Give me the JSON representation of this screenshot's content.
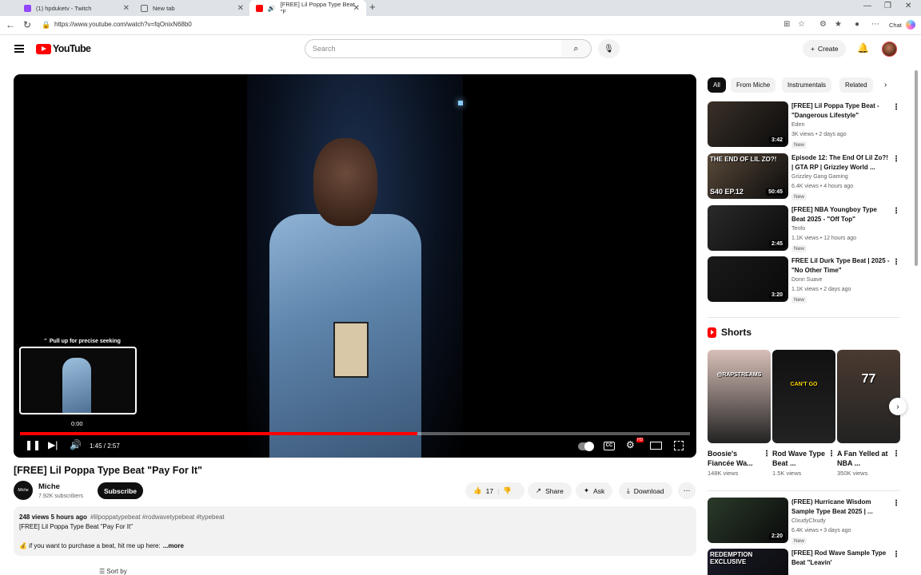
{
  "browser": {
    "tabs": [
      {
        "label": "(1) hpduketv - Twitch"
      },
      {
        "label": "New tab"
      },
      {
        "label": "[FREE] Lil Poppa Type Beat \"F"
      }
    ],
    "url": "https://www.youtube.com/watch?v=fqOnixN68b0",
    "chat_label": "Chat"
  },
  "header": {
    "logo": "YouTube",
    "search_placeholder": "Search",
    "create_label": "Create"
  },
  "player": {
    "seek_hint": "Pull up for precise seeking",
    "preview_time": "0:00",
    "time": "1:45 / 2:57",
    "progress_played_pct": 59.3,
    "progress_buffer_pct": 59.3,
    "cc_label": "CC",
    "settings_badge": "HD"
  },
  "video": {
    "title": "[FREE] Lil Poppa Type Beat \"Pay For It\"",
    "channel": "Miche",
    "channel_avatar_text": "Miche",
    "subscribers": "7.92K subscribers",
    "subscribe_label": "Subscribe",
    "likes": "17",
    "share_label": "Share",
    "ask_label": "Ask",
    "download_label": "Download"
  },
  "description": {
    "meta": "248 views  5 hours ago",
    "tags": "#lilpoppatypebeat #rodwavetypebeat #typebeat",
    "line1": "[FREE] Lil Poppa Type Beat \"Pay For It\"",
    "line2": "💰 if you want to purchase a beat, hit me up here:",
    "more": "...more"
  },
  "comments": {
    "sort_label": "Sort by"
  },
  "chips": [
    {
      "label": "All"
    },
    {
      "label": "From Miche"
    },
    {
      "label": "Instrumentals"
    },
    {
      "label": "Related"
    }
  ],
  "recommendations": [
    {
      "title": "[FREE] Lil Poppa Type Beat - \"Dangerous Lifestyle\"",
      "channel": "Eden",
      "stats": "3K views • 2 days ago",
      "badge": "New",
      "duration": "3:42",
      "thumb_color": "#3a3028"
    },
    {
      "title": "Episode 12: The End Of Lil Zo?! | GTA RP | Grizzley World ...",
      "channel": "Grizzley Gang Gaming",
      "stats": "6.4K views • 4 hours ago",
      "badge": "New",
      "duration": "50:45",
      "thumb_color": "#5a4a3a",
      "overlay_top": "THE END OF LIL ZO?!",
      "overlay_bottom": "S40 EP.12"
    },
    {
      "title": "[FREE] NBA Youngboy Type Beat 2025 - \"Off Top\"",
      "channel": "Tenfo",
      "stats": "1.1K views • 12 hours ago",
      "badge": "New",
      "duration": "2:45",
      "thumb_color": "#2a2a2a"
    },
    {
      "title": "FREE Lil Durk Type Beat | 2025 - \"No Other Time\"",
      "channel": "Donn Suave",
      "stats": "1.1K views • 2 days ago",
      "badge": "New",
      "duration": "3:20",
      "thumb_color": "#1a1a1a"
    }
  ],
  "shorts": {
    "header": "Shorts",
    "items": [
      {
        "title": "Boosie's Fiancée Wa...",
        "views": "148K views",
        "thumb_color": "#d8c0b8",
        "tag": "@RAPSTREAMS"
      },
      {
        "title": "Rod Wave Type Beat ...",
        "views": "1.5K views",
        "thumb_color": "#111111",
        "tag": "CAN'T GO"
      },
      {
        "title": "A Fan Yelled at NBA ...",
        "views": "350K views",
        "thumb_color": "#4a3a30",
        "tag": "77"
      }
    ]
  },
  "recommendations_more": [
    {
      "title": "(FREE) Hurricane Wisdom Sample Type Beat 2025 | ...",
      "channel": "ClxudyClxudy",
      "stats": "6.4K views • 3 days ago",
      "badge": "New",
      "duration": "2:20",
      "thumb_color": "#2a3a2a"
    },
    {
      "title": "[FREE] Rod Wave Sample Type Beat \"Leavin'",
      "channel": "",
      "stats": "",
      "badge": "",
      "duration": "",
      "thumb_color": "#1a1a2a",
      "overlay_top": "REDEMPTION EXCLUSIVE"
    }
  ],
  "colors": {
    "accent": "#ff0000",
    "progress": "#ff0000"
  }
}
